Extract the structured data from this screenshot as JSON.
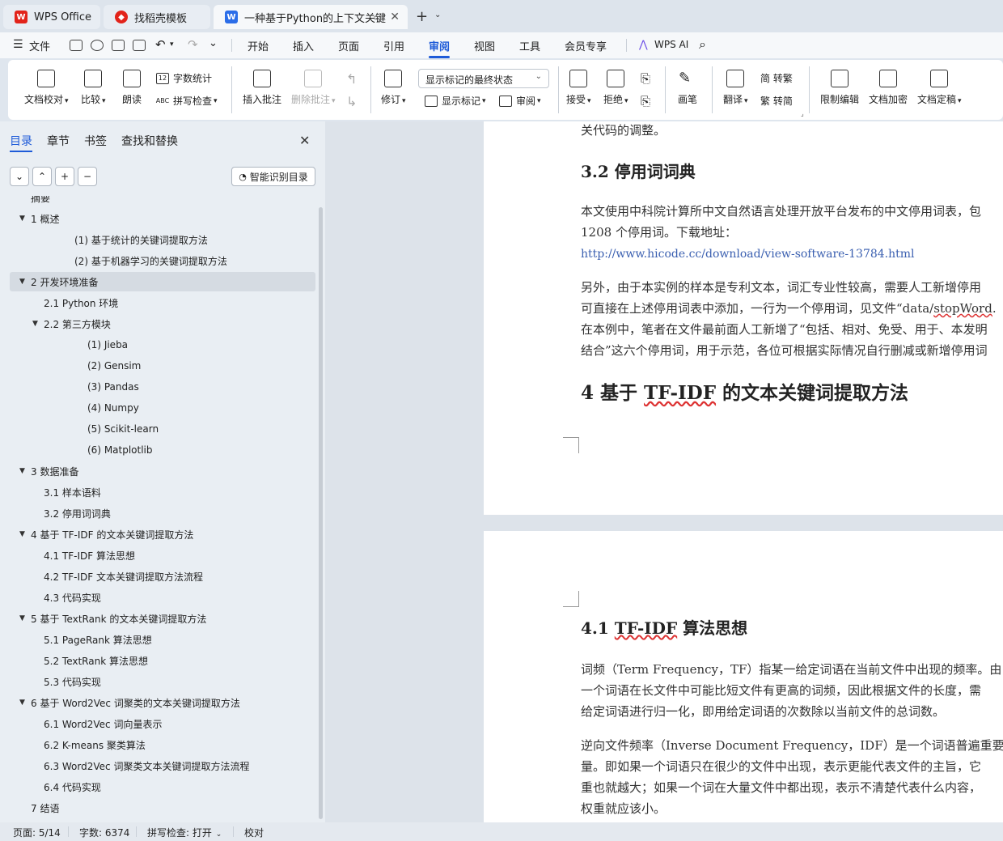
{
  "tabs": [
    {
      "label": "WPS Office",
      "icon": "wps-logo-icon"
    },
    {
      "label": "找稻壳模板",
      "icon": "docer-icon"
    },
    {
      "label": "一种基于Python的上下文关键",
      "icon": "writer-doc-icon"
    }
  ],
  "menu": {
    "file": "文件",
    "items": [
      "开始",
      "插入",
      "页面",
      "引用",
      "审阅",
      "视图",
      "工具",
      "会员专享"
    ],
    "active": "审阅",
    "ai": "WPS AI"
  },
  "ribbon": {
    "proofread": "文档校对",
    "compare": "比较",
    "read_aloud": "朗读",
    "word_count": "字数统计",
    "spell_check": "拼写检查",
    "insert_comment": "插入批注",
    "delete_comment": "删除批注",
    "track_changes": "修订",
    "markup_select": "显示标记的最终状态",
    "show_markup": "显示标记",
    "review": "审阅",
    "accept": "接受",
    "reject": "拒绝",
    "pen": "画笔",
    "translate": "翻译",
    "to_traditional": "简 转繁",
    "to_simplified": "繁 转简",
    "restrict_edit": "限制编辑",
    "encrypt": "文档加密",
    "finalize": "文档定稿"
  },
  "nav": {
    "tabs": [
      "目录",
      "章节",
      "书签",
      "查找和替换"
    ],
    "smart_toc": "智能识别目录",
    "toc": [
      {
        "label": "摘要",
        "indent": 0,
        "arrow": ""
      },
      {
        "label": "1  概述",
        "indent": 0,
        "arrow": "▼"
      },
      {
        "label": "(1)  基于统计的关键词提取方法",
        "indent": 3,
        "arrow": ""
      },
      {
        "label": "(2)  基于机器学习的关键词提取方法",
        "indent": 3,
        "arrow": ""
      },
      {
        "label": "2  开发环境准备",
        "indent": 0,
        "arrow": "▼",
        "selected": true
      },
      {
        "label": "2.1 Python 环境",
        "indent": 1,
        "arrow": ""
      },
      {
        "label": "2.2  第三方模块",
        "indent": 1,
        "arrow": "▼"
      },
      {
        "label": "(1)  Jieba",
        "indent": 4,
        "arrow": ""
      },
      {
        "label": "(2)  Gensim",
        "indent": 4,
        "arrow": ""
      },
      {
        "label": "(3)  Pandas",
        "indent": 4,
        "arrow": ""
      },
      {
        "label": "(4)  Numpy",
        "indent": 4,
        "arrow": ""
      },
      {
        "label": "(5)  Scikit-learn",
        "indent": 4,
        "arrow": ""
      },
      {
        "label": "(6)  Matplotlib",
        "indent": 4,
        "arrow": ""
      },
      {
        "label": "3  数据准备",
        "indent": 0,
        "arrow": "▼"
      },
      {
        "label": "3.1  样本语料",
        "indent": 1,
        "arrow": ""
      },
      {
        "label": "3.2  停用词词典",
        "indent": 1,
        "arrow": ""
      },
      {
        "label": "4  基于 TF-IDF 的文本关键词提取方法",
        "indent": 0,
        "arrow": "▼"
      },
      {
        "label": "4.1 TF-IDF 算法思想",
        "indent": 1,
        "arrow": ""
      },
      {
        "label": "4.2 TF-IDF 文本关键词提取方法流程",
        "indent": 1,
        "arrow": ""
      },
      {
        "label": "4.3  代码实现",
        "indent": 1,
        "arrow": ""
      },
      {
        "label": "5  基于 TextRank 的文本关键词提取方法",
        "indent": 0,
        "arrow": "▼"
      },
      {
        "label": "5.1 PageRank 算法思想",
        "indent": 1,
        "arrow": ""
      },
      {
        "label": "5.2 TextRank 算法思想",
        "indent": 1,
        "arrow": ""
      },
      {
        "label": "5.3  代码实现",
        "indent": 1,
        "arrow": ""
      },
      {
        "label": "6  基于 Word2Vec 词聚类的文本关键词提取方法",
        "indent": 0,
        "arrow": "▼"
      },
      {
        "label": "6.1 Word2Vec 词向量表示",
        "indent": 1,
        "arrow": ""
      },
      {
        "label": "6.2 K-means 聚类算法",
        "indent": 1,
        "arrow": ""
      },
      {
        "label": "6.3 Word2Vec 词聚类文本关键词提取方法流程",
        "indent": 1,
        "arrow": ""
      },
      {
        "label": "6.4  代码实现",
        "indent": 1,
        "arrow": ""
      },
      {
        "label": "7  结语",
        "indent": 0,
        "arrow": ""
      }
    ]
  },
  "doc": {
    "line0": "关代码的调整。",
    "h32": "3.2  停用词词典",
    "p1a": "本文使用中科院计算所中文自然语言处理开放平台发布的中文停用词表，包",
    "p1b": "1208 个停用词。下载地址：",
    "link": "http://www.hicode.cc/download/view-software-13784.html",
    "p2a": "另外，由于本实例的样本是专利文本，词汇专业性较高，需要人工新增停用",
    "p2b_pre": "可直接在上述停用词表中添加，一行为一个停用词，见文件“data/",
    "p2b_sq": "stopWord",
    "p2b_post": ".",
    "p2c": "在本例中，笔者在文件最前面人工新增了“包括、相对、免受、用于、本发明",
    "p2d": "结合”这六个停用词，用于示范，各位可根据实际情况自行删减或新增停用词",
    "h4_pre": "4  基于 ",
    "h4_sq": "TF-IDF",
    "h4_post": " 的文本关键词提取方法",
    "h41_pre": "4.1 ",
    "h41_sq": "TF-IDF",
    "h41_post": " 算法思想",
    "p3a": "词频（Term Frequency，TF）指某一给定词语在当前文件中出现的频率。由",
    "p3b": "一个词语在长文件中可能比短文件有更高的词频，因此根据文件的长度，需",
    "p3c": "给定词语进行归一化，即用给定词语的次数除以当前文件的总词数。",
    "p4a": "逆向文件频率（Inverse Document Frequency，IDF）是一个词语普遍重要性的",
    "p4b": "量。即如果一个词语只在很少的文件中出现，表示更能代表文件的主旨，它",
    "p4c": "重也就越大；如果一个词在大量文件中都出现，表示不清楚代表什么内容，",
    "p4d": "权重就应该小。"
  },
  "status": {
    "page": "页面: 5/14",
    "words": "字数: 6374",
    "spell": "拼写检查: 打开",
    "proof": "校对"
  },
  "colors": {
    "accent": "#1e5bd8",
    "wps_red": "#e2231a"
  }
}
